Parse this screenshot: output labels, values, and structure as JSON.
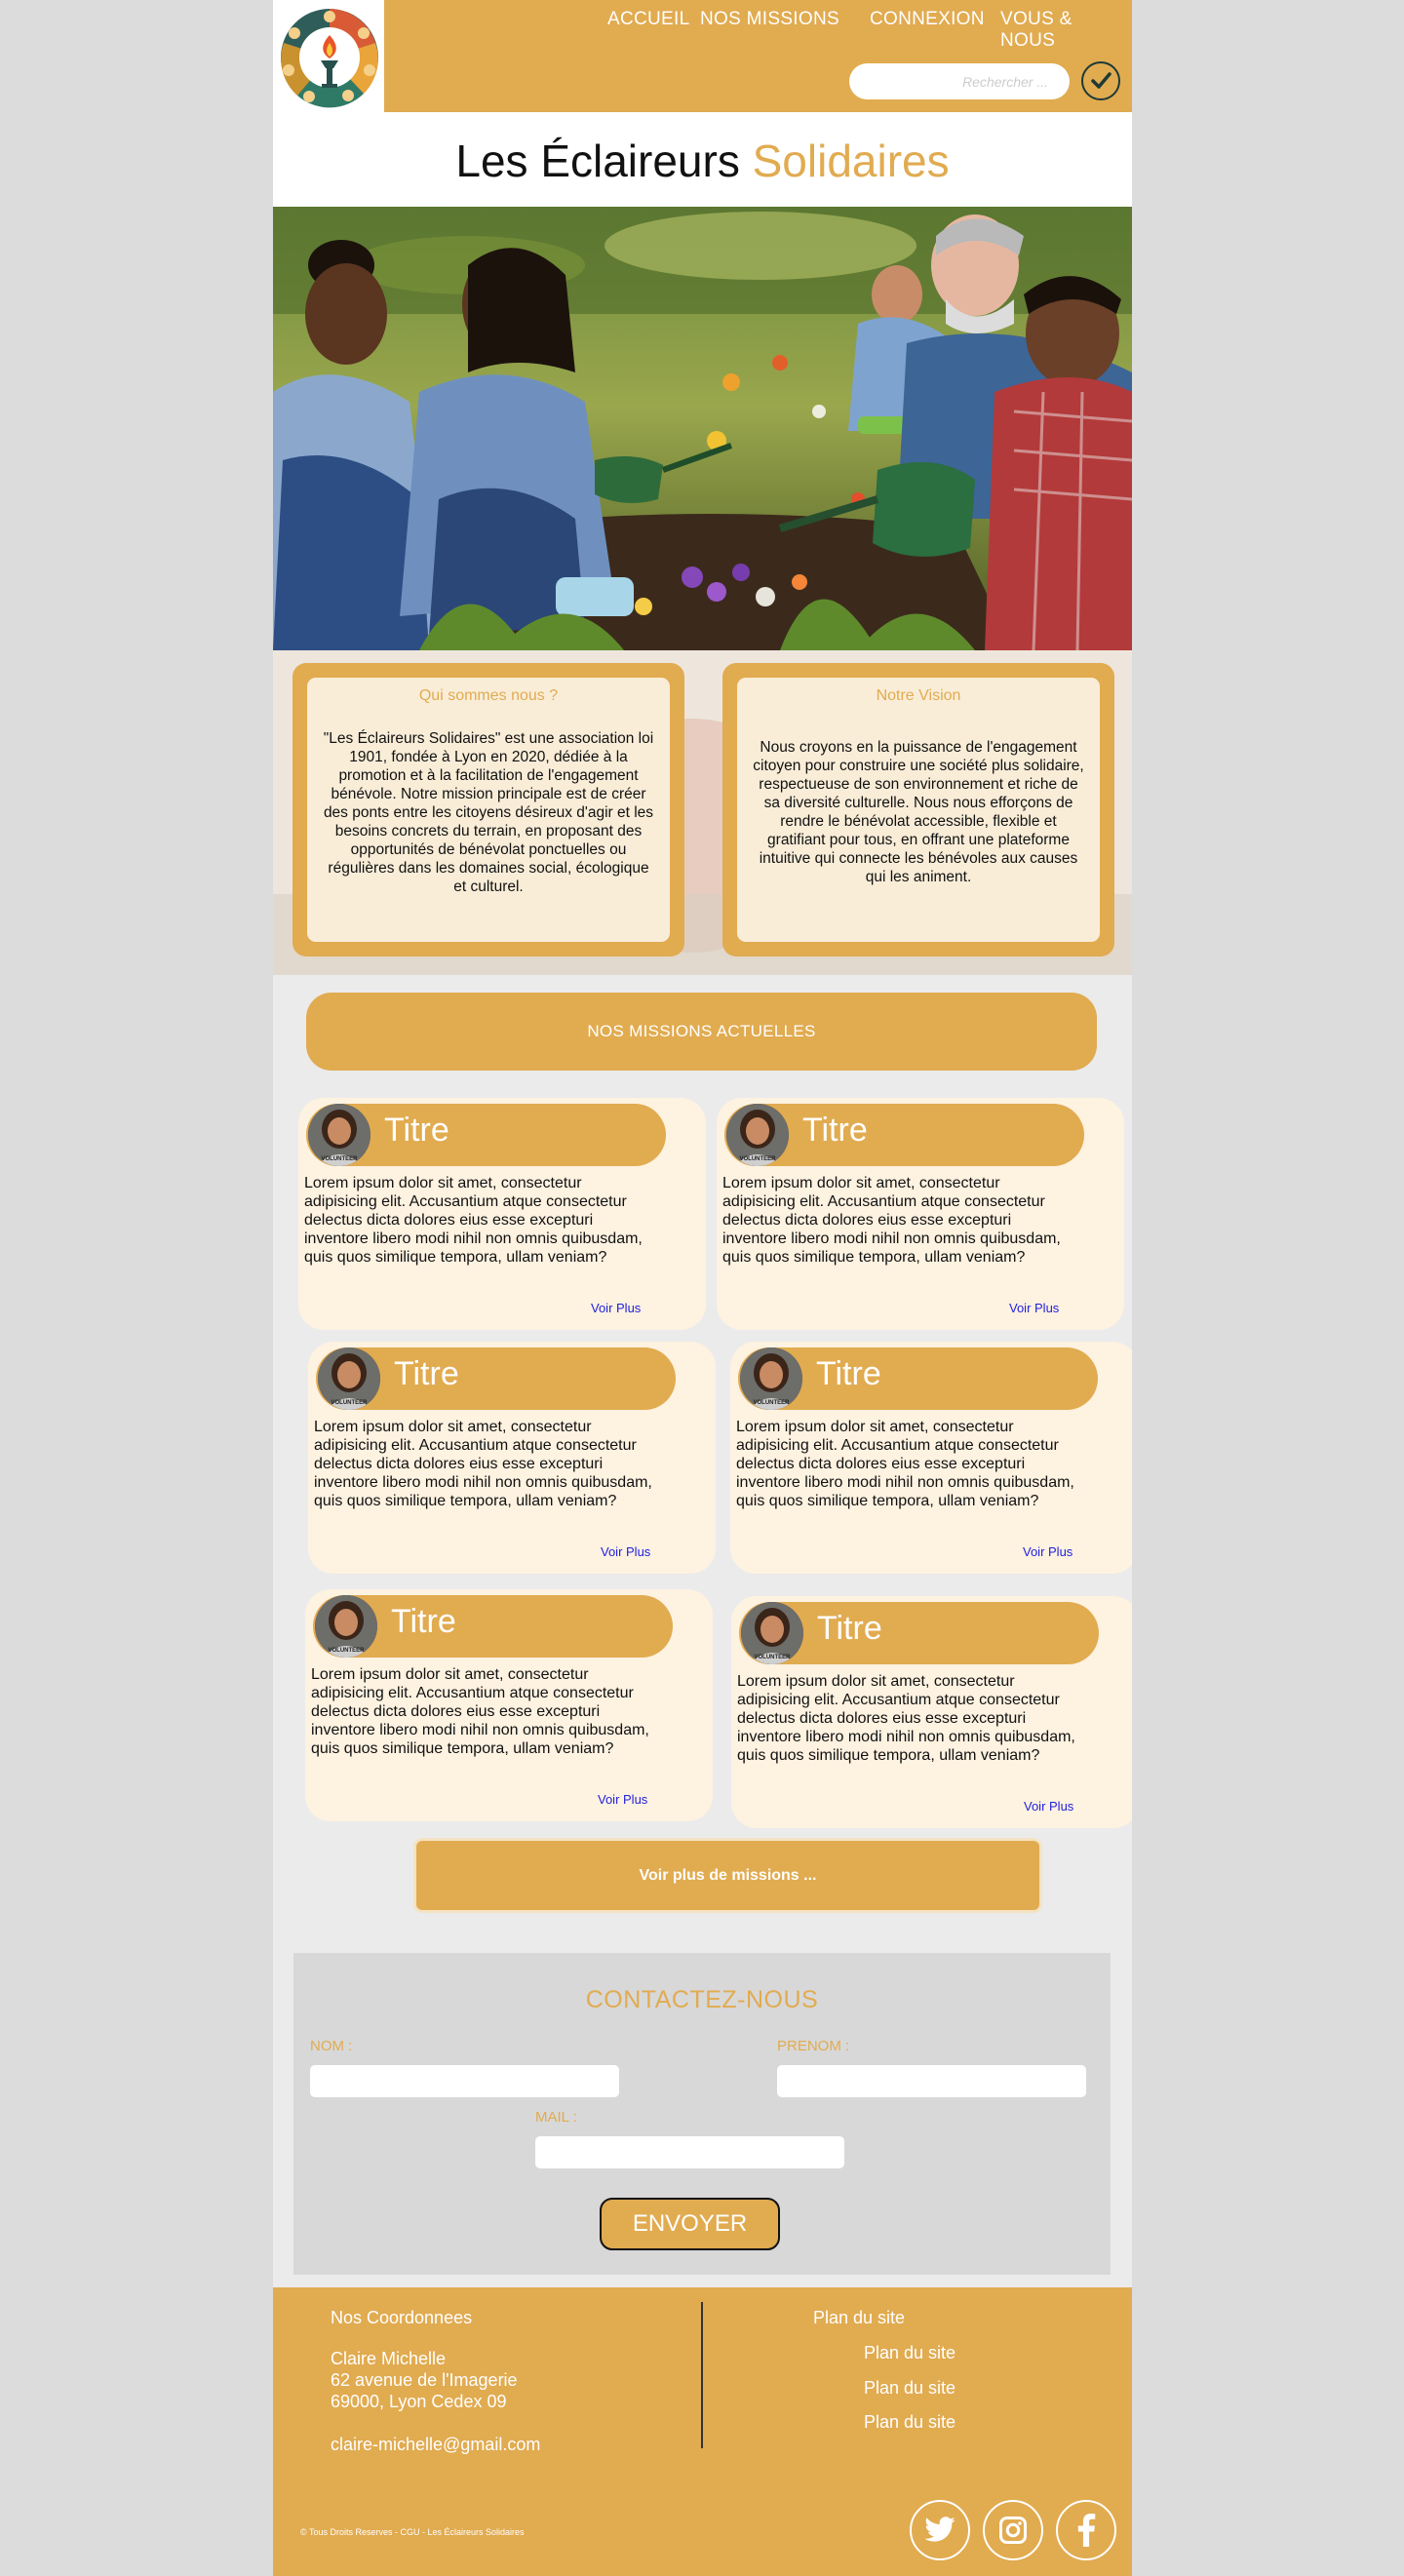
{
  "nav": {
    "home": "ACCUEIL",
    "missions": "NOS MISSIONS",
    "login": "CONNEXION",
    "about": "VOUS & NOUS",
    "search_placeholder": "Rechercher ..."
  },
  "site": {
    "title_main": "Les Éclaireurs",
    "title_accent": "Solidaires"
  },
  "about": {
    "who_title": "Qui sommes nous ?",
    "who_text": "\"Les Éclaireurs Solidaires\" est une association loi 1901, fondée à Lyon en 2020, dédiée à la promotion et à la facilitation de l'engagement bénévole. Notre mission principale est de créer des ponts entre les citoyens désireux d'agir et les besoins concrets du terrain, en proposant des opportunités de bénévolat ponctuelles ou régulières dans les domaines social, écologique et culturel.",
    "vision_title": "Notre Vision",
    "vision_text": "Nous croyons en la puissance de l'engagement citoyen pour construire une société plus solidaire, respectueuse de son environnement et riche de sa diversité culturelle. Nous nous efforçons de rendre le bénévolat accessible, flexible et gratifiant pour tous, en offrant une plateforme intuitive qui connecte les bénévoles aux causes qui les animent."
  },
  "missions": {
    "heading": "NOS MISSIONS ACTUELLES",
    "cards": [
      {
        "title": "Titre",
        "text": "Lorem ipsum dolor sit amet, consectetur adipisicing elit. Accusantium atque consectetur delectus dicta dolores eius esse excepturi inventore libero modi nihil non omnis quibusdam, quis quos similique tempora, ullam veniam?",
        "more": "Voir Plus"
      },
      {
        "title": "Titre",
        "text": "Lorem ipsum dolor sit amet, consectetur adipisicing elit. Accusantium atque consectetur delectus dicta dolores eius esse excepturi inventore libero modi nihil non omnis quibusdam, quis quos similique tempora, ullam veniam?",
        "more": "Voir Plus"
      },
      {
        "title": "Titre",
        "text": "Lorem ipsum dolor sit amet, consectetur adipisicing elit. Accusantium atque consectetur delectus dicta dolores eius esse excepturi inventore libero modi nihil non omnis quibusdam, quis quos similique tempora, ullam veniam?",
        "more": "Voir Plus"
      },
      {
        "title": "Titre",
        "text": "Lorem ipsum dolor sit amet, consectetur adipisicing elit. Accusantium atque consectetur delectus dicta dolores eius esse excepturi inventore libero modi nihil non omnis quibusdam, quis quos similique tempora, ullam veniam?",
        "more": "Voir Plus"
      },
      {
        "title": "Titre",
        "text": "Lorem ipsum dolor sit amet, consectetur adipisicing elit. Accusantium atque consectetur delectus dicta dolores eius esse excepturi inventore libero modi nihil non omnis quibusdam, quis quos similique tempora, ullam veniam?",
        "more": "Voir Plus"
      },
      {
        "title": "Titre",
        "text": "Lorem ipsum dolor sit amet, consectetur adipisicing elit. Accusantium atque consectetur delectus dicta dolores eius esse excepturi inventore libero modi nihil non omnis quibusdam, quis quos similique tempora, ullam veniam?",
        "more": "Voir Plus"
      }
    ],
    "badge_text": "VOLUNTEER",
    "more_button": "Voir plus de missions ..."
  },
  "contact": {
    "heading": "CONTACTEZ-NOUS",
    "nom_label": "NOM :",
    "prenom_label": "PRENOM :",
    "mail_label": "MAIL :",
    "send": "ENVOYER"
  },
  "footer": {
    "coords_title": "Nos Coordonnees",
    "name": "Claire Michelle",
    "address1": "62 avenue de l'Imagerie",
    "address2": "69000, Lyon Cedex 09",
    "email": "claire-michelle@gmail.com",
    "sitemap_title": "Plan du site",
    "sitemap_items": [
      "Plan du site",
      "Plan du site",
      "Plan du site"
    ],
    "copyright": "© Tous Droits Reserves - CGU - Les Éclaireurs Solidaires"
  },
  "icons": [
    "checkmark-icon",
    "twitter-icon",
    "instagram-icon",
    "facebook-icon"
  ],
  "colors": {
    "accent": "#e1ab50",
    "card_bg": "#fef2e1",
    "link": "#2222dd"
  }
}
